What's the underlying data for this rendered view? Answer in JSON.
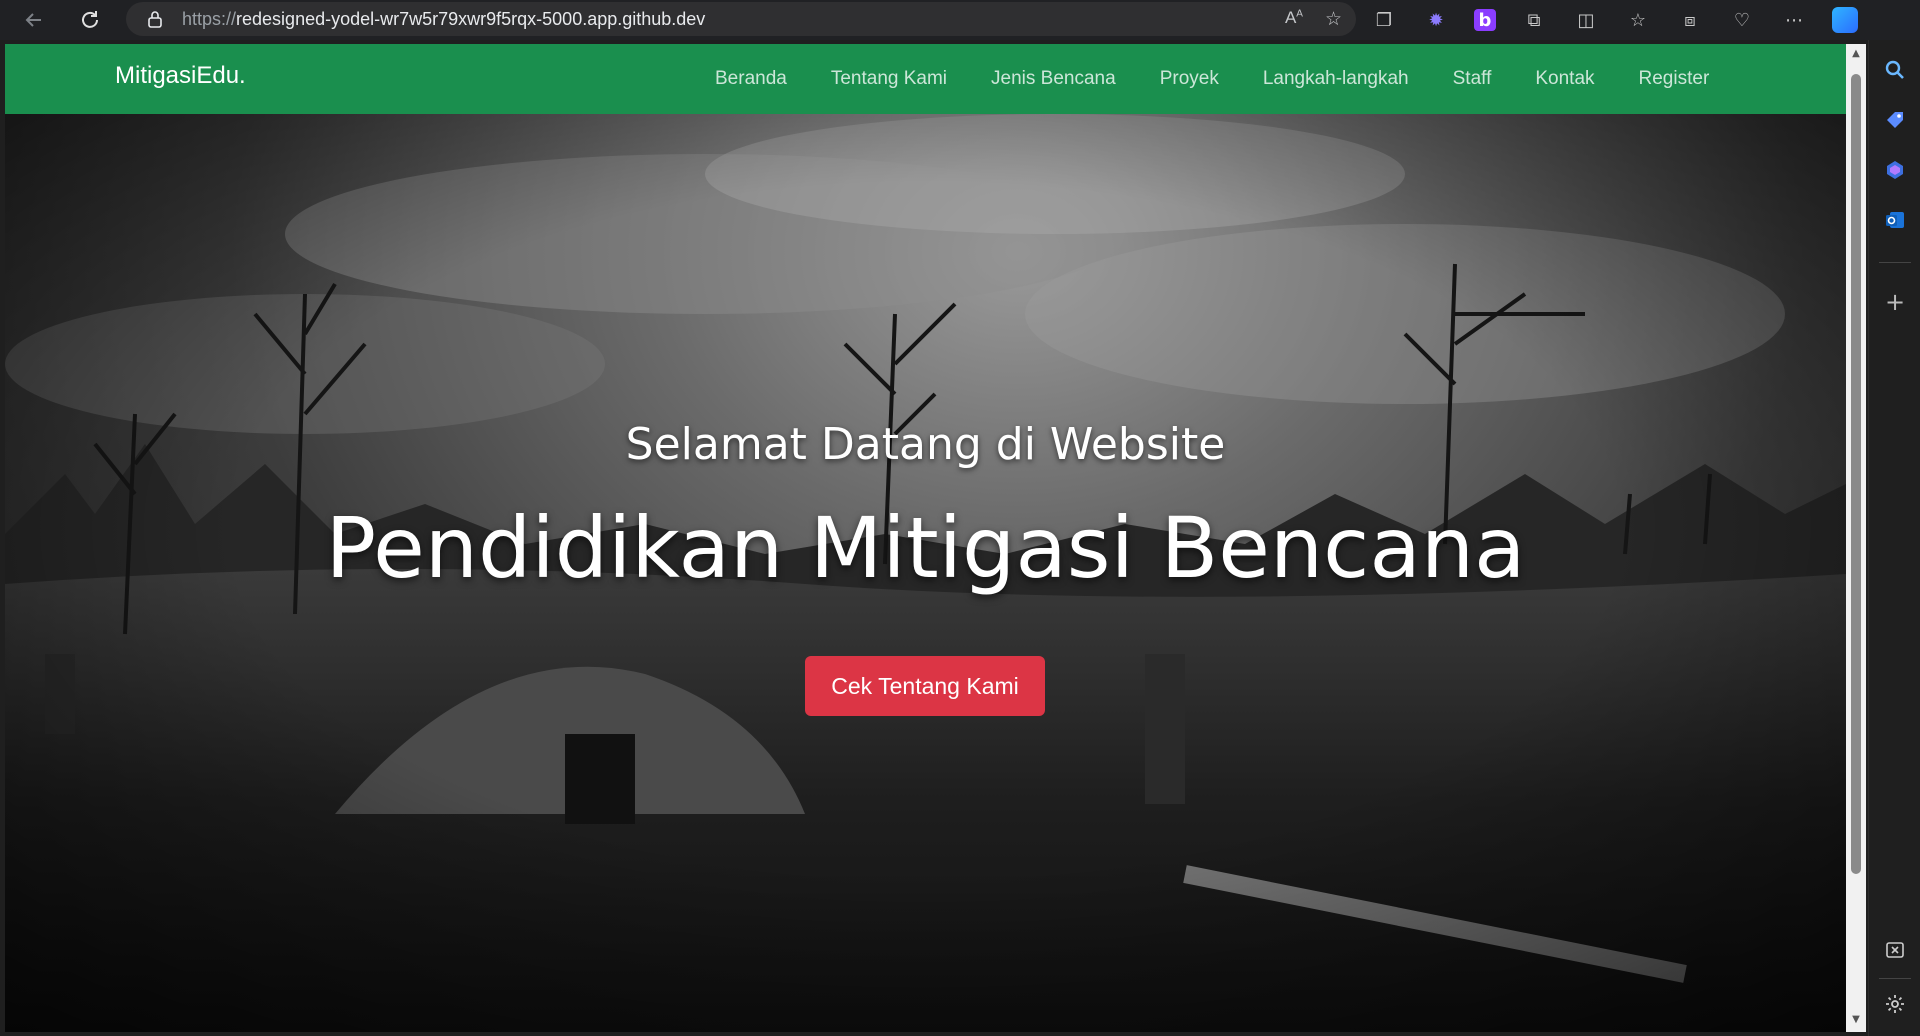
{
  "browser": {
    "url_protocol": "https://",
    "url_host": "redesigned-yodel-wr7w5r79xwr9f5rqx-5000.app.github.dev",
    "read_aloud_label": "Aᴬ"
  },
  "site": {
    "brand": "MitigasiEdu.",
    "nav": [
      {
        "label": "Beranda"
      },
      {
        "label": "Tentang Kami"
      },
      {
        "label": "Jenis Bencana"
      },
      {
        "label": "Proyek"
      },
      {
        "label": "Langkah-langkah"
      },
      {
        "label": "Staff"
      },
      {
        "label": "Kontak"
      },
      {
        "label": "Register"
      }
    ],
    "nav_color": "#1a8f4e"
  },
  "hero": {
    "subtitle": "Selamat Datang di Website",
    "title": "Pendidikan Mitigasi Bencana",
    "button_label": "Cek Tentang Kami",
    "button_color": "#dc3545"
  }
}
